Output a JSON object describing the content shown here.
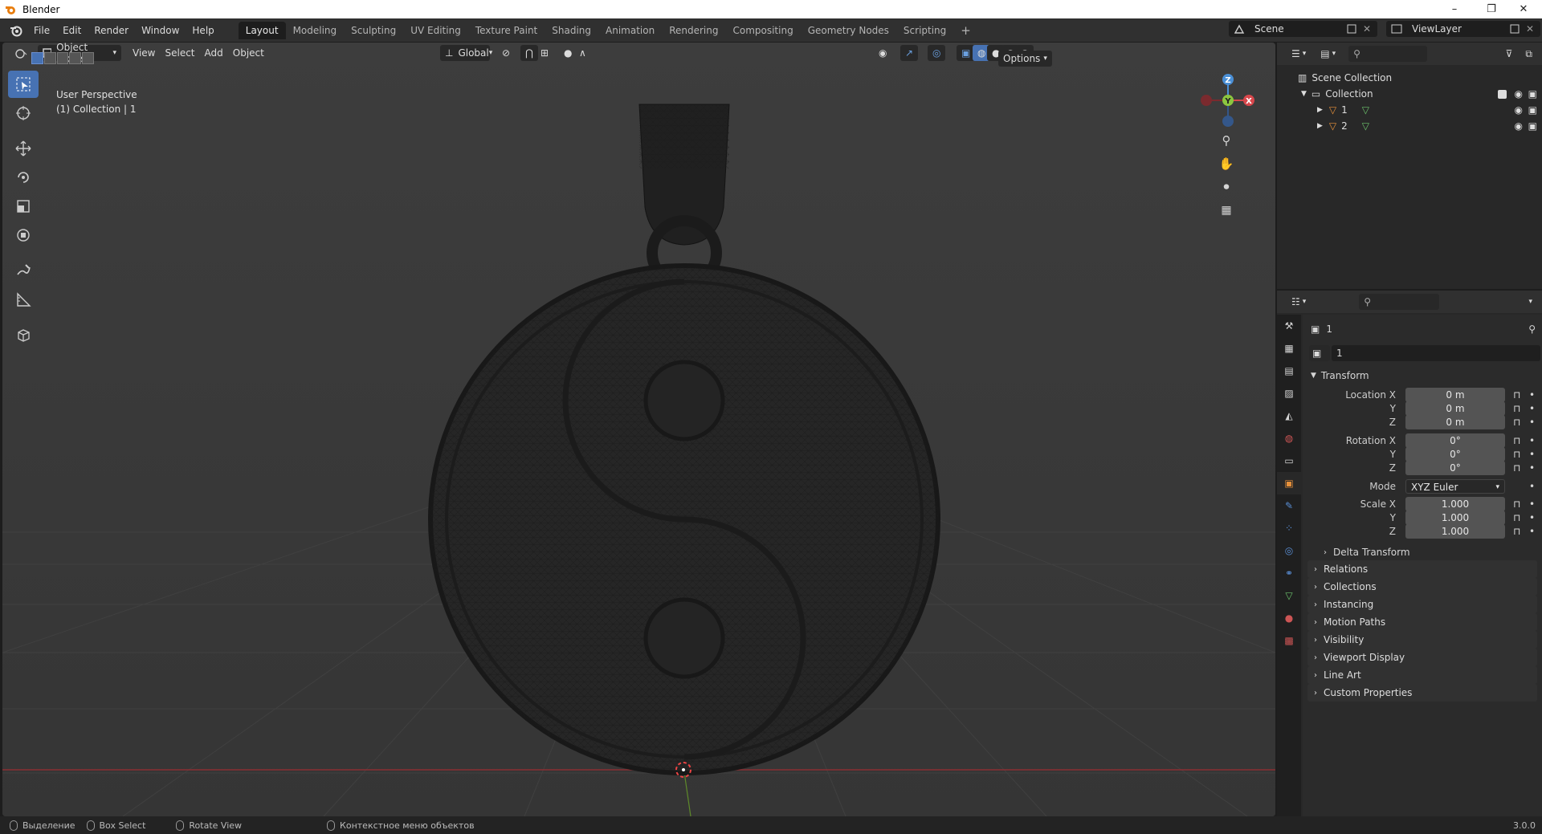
{
  "window": {
    "title": "Blender",
    "minimize": "–",
    "maximize": "❐",
    "close": "✕"
  },
  "menu": [
    "File",
    "Edit",
    "Render",
    "Window",
    "Help"
  ],
  "workspaces": [
    "Layout",
    "Modeling",
    "Sculpting",
    "UV Editing",
    "Texture Paint",
    "Shading",
    "Animation",
    "Rendering",
    "Compositing",
    "Geometry Nodes",
    "Scripting"
  ],
  "add_workspace": "+",
  "scene": "Scene",
  "view_layer": "ViewLayer",
  "viewport": {
    "mode": "Object Mode",
    "menus": [
      "View",
      "Select",
      "Add",
      "Object"
    ],
    "orientation": "Global",
    "options": "Options",
    "info_line1": "User Perspective",
    "info_line2": "(1) Collection | 1",
    "gizmo": {
      "z": "Z",
      "y": "Y",
      "x": "X"
    }
  },
  "outliner": {
    "scene_collection": "Scene Collection",
    "collection": "Collection",
    "objects": [
      "1",
      "2"
    ]
  },
  "properties": {
    "object_name": "1",
    "data_name": "1",
    "transform_title": "Transform",
    "location_label": "Location X",
    "rotation_label": "Rotation X",
    "scale_label": "Scale X",
    "y_label": "Y",
    "z_label": "Z",
    "location": [
      "0 m",
      "0 m",
      "0 m"
    ],
    "rotation": [
      "0°",
      "0°",
      "0°"
    ],
    "mode_label": "Mode",
    "mode_value": "XYZ Euler",
    "scale": [
      "1.000",
      "1.000",
      "1.000"
    ],
    "delta": "Delta Transform",
    "panels": [
      "Relations",
      "Collections",
      "Instancing",
      "Motion Paths",
      "Visibility",
      "Viewport Display",
      "Line Art",
      "Custom Properties"
    ]
  },
  "status": {
    "select": "Выделение",
    "box_select": "Box Select",
    "rotate_view": "Rotate View",
    "context_menu": "Контекстное меню объектов",
    "version": "3.0.0"
  },
  "colors": {
    "accent": "#4772b3",
    "x_axis": "#d8474c",
    "y_axis": "#8cc63f",
    "z_axis": "#4a8fd6",
    "header": "#303030",
    "panel": "#282828"
  }
}
